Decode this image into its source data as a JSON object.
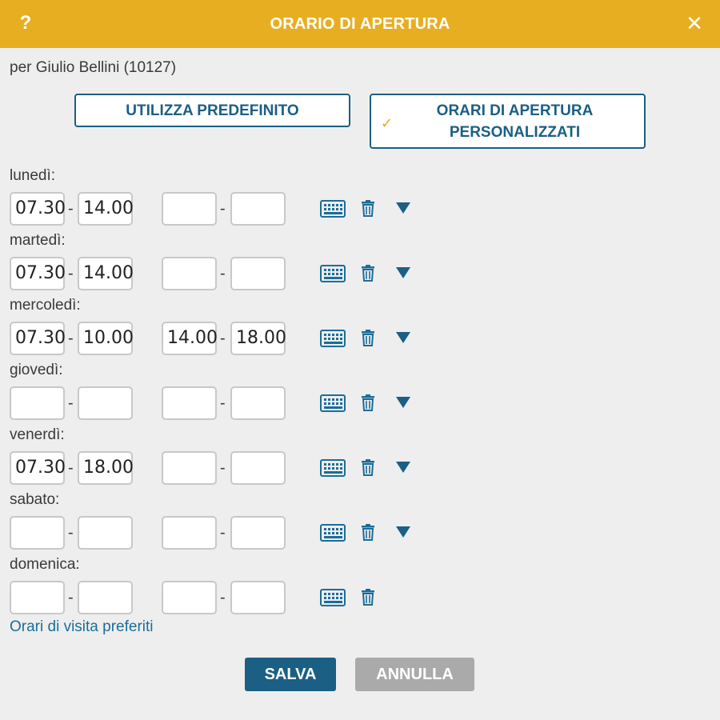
{
  "header": {
    "title": "ORARIO DI APERTURA",
    "help_label": "?",
    "close_label": "✕"
  },
  "subtitle": "per Giulio Bellini (10127)",
  "modes": {
    "default_label": "UTILIZZA PREDEFINITO",
    "custom_label": "ORARI DI APERTURA PERSONALIZZATI",
    "custom_checkmark": "✓"
  },
  "separator": "-",
  "days": [
    {
      "label": "lunedì:",
      "from1": "07.30",
      "to1": "14.00",
      "from2": "",
      "to2": "",
      "has_dropdown": true
    },
    {
      "label": "martedì:",
      "from1": "07.30",
      "to1": "14.00",
      "from2": "",
      "to2": "",
      "has_dropdown": true
    },
    {
      "label": "mercoledì:",
      "from1": "07.30",
      "to1": "10.00",
      "from2": "14.00",
      "to2": "18.00",
      "has_dropdown": true
    },
    {
      "label": "giovedì:",
      "from1": "",
      "to1": "",
      "from2": "",
      "to2": "",
      "has_dropdown": true
    },
    {
      "label": "venerdì:",
      "from1": "07.30",
      "to1": "18.00",
      "from2": "",
      "to2": "",
      "has_dropdown": true
    },
    {
      "label": "sabato:",
      "from1": "",
      "to1": "",
      "from2": "",
      "to2": "",
      "has_dropdown": true
    },
    {
      "label": "domenica:",
      "from1": "",
      "to1": "",
      "from2": "",
      "to2": "",
      "has_dropdown": false
    }
  ],
  "preferred_link": "Orari di visita preferiti",
  "buttons": {
    "save": "SALVA",
    "cancel": "ANNULLA"
  },
  "colors": {
    "accent": "#e8ae21",
    "primary": "#1b5f84",
    "disabled": "#aaaaaa"
  },
  "icons": {
    "row_icons": [
      "keyboard-icon",
      "trash-icon",
      "caret-down-icon"
    ]
  }
}
